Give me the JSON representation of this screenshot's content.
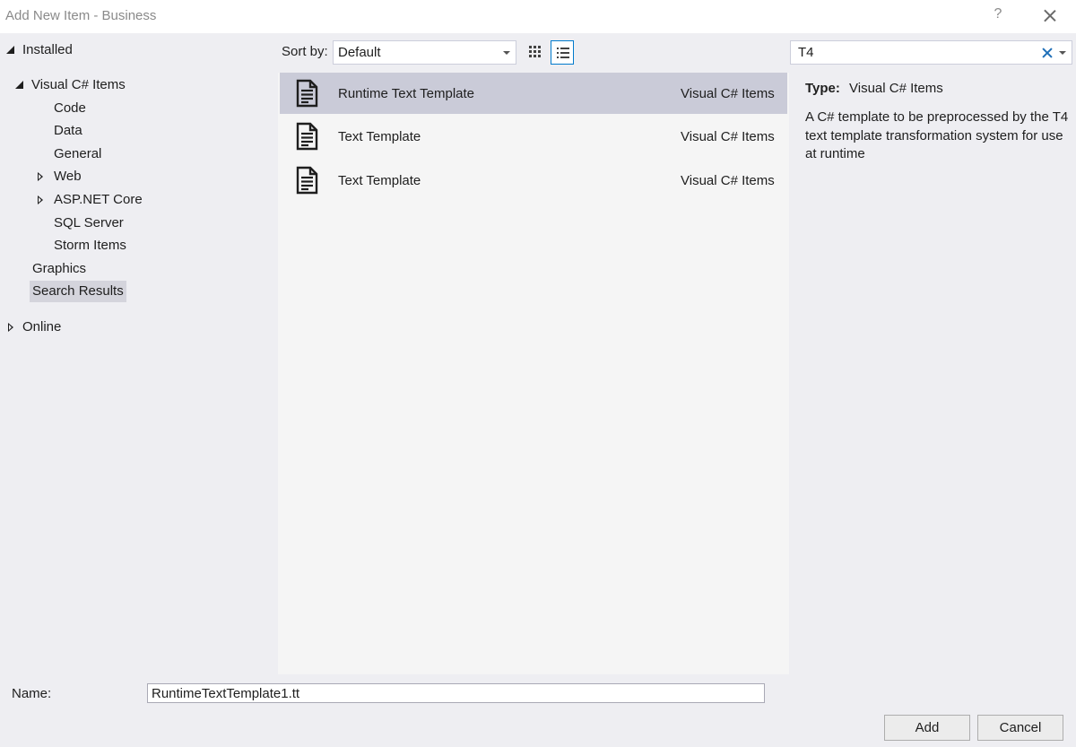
{
  "window": {
    "title": "Add New Item - Business",
    "help_glyph": "?"
  },
  "tree": {
    "installed": "Installed",
    "visual_csharp": "Visual C# Items",
    "children": [
      "Code",
      "Data",
      "General",
      "Web",
      "ASP.NET Core",
      "SQL Server",
      "Storm Items"
    ],
    "graphics": "Graphics",
    "search_results": "Search Results",
    "online": "Online"
  },
  "toolbar": {
    "sort_label": "Sort by:",
    "sort_value": "Default",
    "view_mode": "list"
  },
  "search": {
    "value": "T4"
  },
  "items": [
    {
      "name": "Runtime Text Template",
      "category": "Visual C# Items",
      "selected": true
    },
    {
      "name": "Text Template",
      "category": "Visual C# Items",
      "selected": false
    },
    {
      "name": "Text Template",
      "category": "Visual C# Items",
      "selected": false
    }
  ],
  "details": {
    "type_label": "Type:",
    "type_value": "Visual C# Items",
    "description": "A C# template to be preprocessed by the T4 text template transformation system for use at runtime"
  },
  "footer": {
    "name_label": "Name:",
    "name_value": "RuntimeTextTemplate1.tt",
    "add_label": "Add",
    "cancel_label": "Cancel"
  },
  "colors": {
    "accent": "#007acc",
    "selection": "#cacbd8",
    "background": "#eeeef2"
  }
}
